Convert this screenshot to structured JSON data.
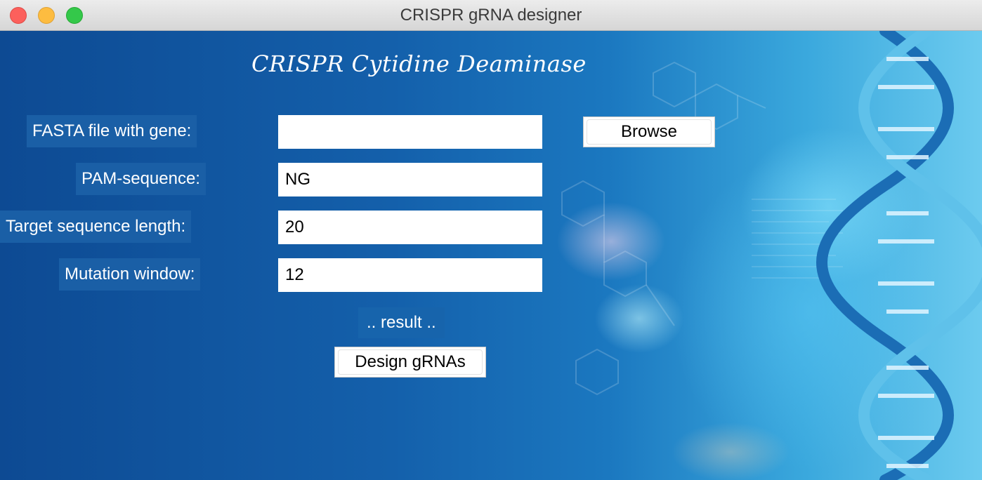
{
  "window": {
    "title": "CRISPR gRNA designer"
  },
  "app": {
    "title": "CRISPR Cytidine Deaminase"
  },
  "form": {
    "fasta_label": "FASTA file with gene:",
    "fasta_value": "",
    "pam_label": "PAM-sequence:",
    "pam_value": "NG",
    "length_label": "Target sequence length:",
    "length_value": "20",
    "window_label": "Mutation window:",
    "window_value": "12"
  },
  "buttons": {
    "browse": "Browse",
    "design": "Design gRNAs"
  },
  "status": {
    "result": ".. result .."
  },
  "colors": {
    "background": "#1460ab",
    "accent_light": "#6ccbef",
    "label_bg": "#1a5fa6"
  }
}
